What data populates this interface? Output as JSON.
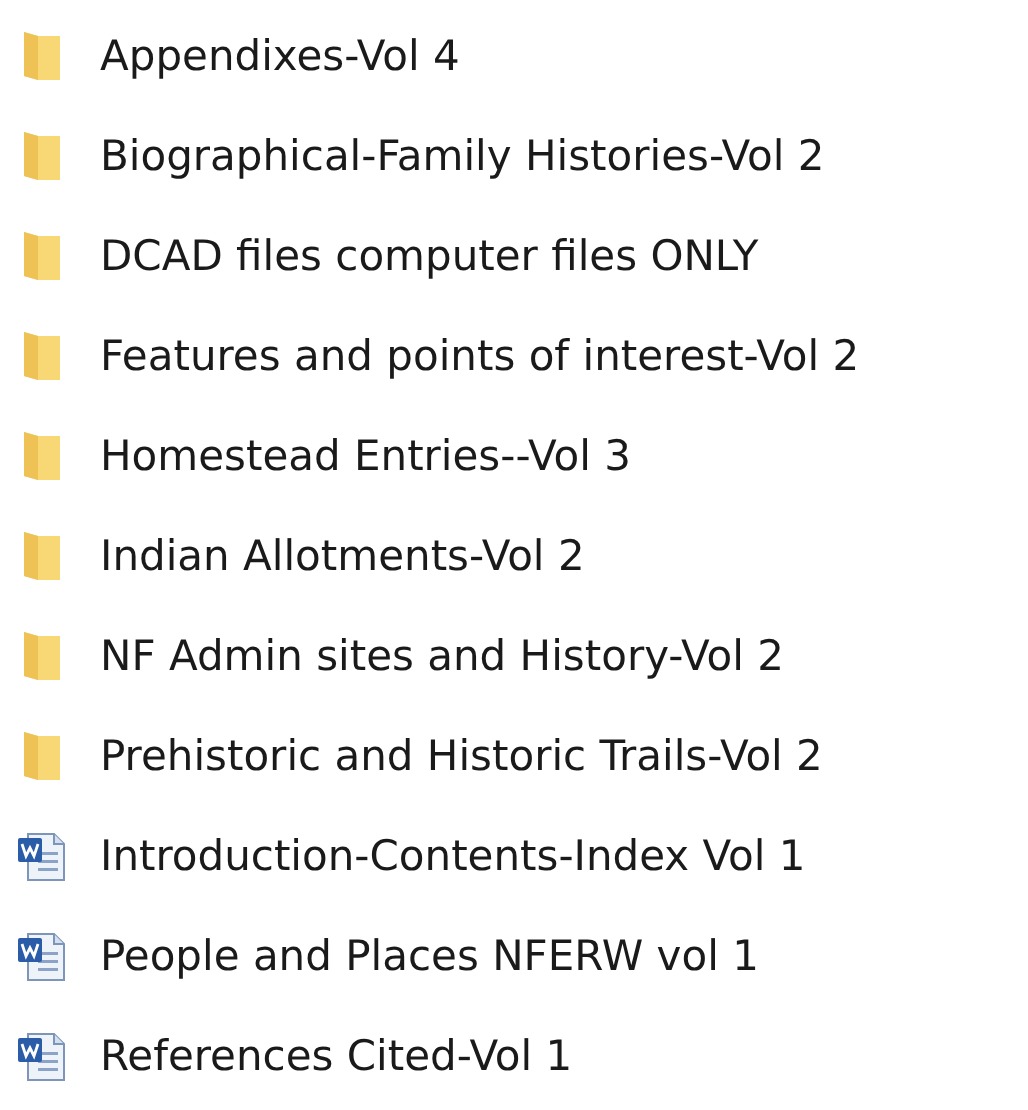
{
  "items": [
    {
      "kind": "folder",
      "name": "Appendixes-Vol 4"
    },
    {
      "kind": "folder",
      "name": "Biographical-Family Histories-Vol 2"
    },
    {
      "kind": "folder",
      "name": "DCAD files computer files ONLY"
    },
    {
      "kind": "folder",
      "name": "Features and points of interest-Vol 2"
    },
    {
      "kind": "folder",
      "name": "Homestead Entries--Vol 3"
    },
    {
      "kind": "folder",
      "name": "Indian Allotments-Vol 2"
    },
    {
      "kind": "folder",
      "name": "NF Admin sites and History-Vol 2"
    },
    {
      "kind": "folder",
      "name": "Prehistoric and Historic Trails-Vol 2"
    },
    {
      "kind": "document",
      "name": "Introduction-Contents-Index Vol 1"
    },
    {
      "kind": "document",
      "name": "People and Places NFERW vol 1"
    },
    {
      "kind": "document",
      "name": "References Cited-Vol 1"
    }
  ]
}
